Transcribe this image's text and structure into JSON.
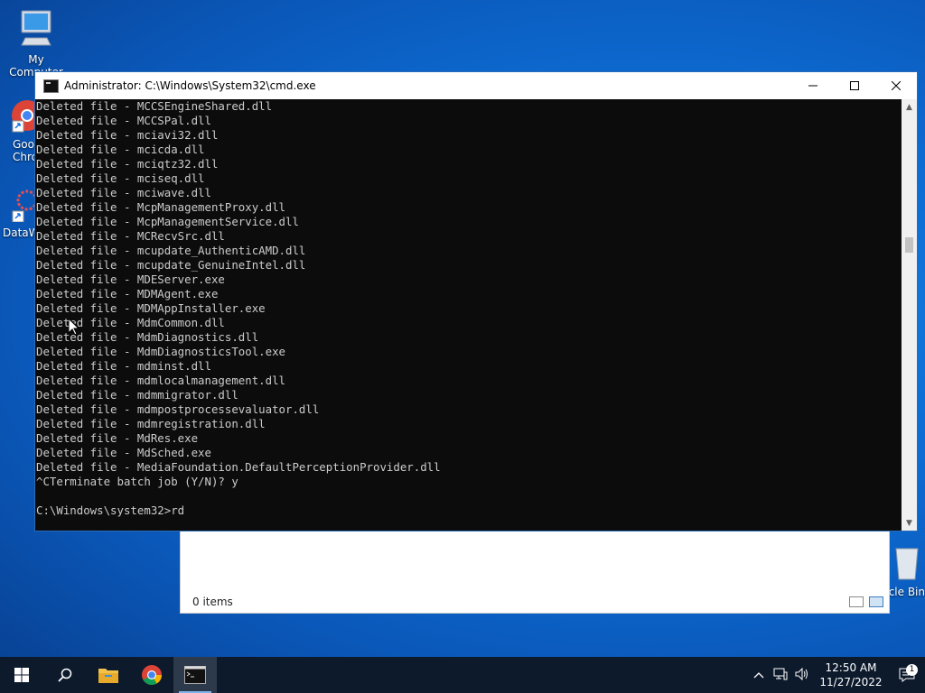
{
  "desktop": {
    "icons": [
      {
        "label": "My Computer",
        "icon": "computer-icon"
      },
      {
        "label": "Google Chrome",
        "icon": "chrome-icon"
      },
      {
        "label": "DataWrangler",
        "icon": "app-shortcut-icon"
      },
      {
        "label": "Recycle Bin",
        "icon": "recycle-bin-icon"
      }
    ]
  },
  "explorer": {
    "status": "0 items"
  },
  "cmd": {
    "title": "Administrator:  C:\\Windows\\System32\\cmd.exe",
    "lines": [
      "Deleted file - MCCSEngineShared.dll",
      "Deleted file - MCCSPal.dll",
      "Deleted file - mciavi32.dll",
      "Deleted file - mcicda.dll",
      "Deleted file - mciqtz32.dll",
      "Deleted file - mciseq.dll",
      "Deleted file - mciwave.dll",
      "Deleted file - McpManagementProxy.dll",
      "Deleted file - McpManagementService.dll",
      "Deleted file - MCRecvSrc.dll",
      "Deleted file - mcupdate_AuthenticAMD.dll",
      "Deleted file - mcupdate_GenuineIntel.dll",
      "Deleted file - MDEServer.exe",
      "Deleted file - MDMAgent.exe",
      "Deleted file - MDMAppInstaller.exe",
      "Deleted file - MdmCommon.dll",
      "Deleted file - MdmDiagnostics.dll",
      "Deleted file - MdmDiagnosticsTool.exe",
      "Deleted file - mdminst.dll",
      "Deleted file - mdmlocalmanagement.dll",
      "Deleted file - mdmmigrator.dll",
      "Deleted file - mdmpostprocessevaluator.dll",
      "Deleted file - mdmregistration.dll",
      "Deleted file - MdRes.exe",
      "Deleted file - MdSched.exe",
      "Deleted file - MediaFoundation.DefaultPerceptionProvider.dll",
      "^CTerminate batch job (Y/N)? y",
      "",
      "C:\\Windows\\system32>rd"
    ],
    "scroll_position": 0.3
  },
  "taskbar": {
    "start_icon": "windows-logo-icon",
    "search_icon": "search-icon",
    "pinned": [
      {
        "name": "file-explorer",
        "icon": "folder-icon"
      },
      {
        "name": "chrome",
        "icon": "chrome-icon"
      },
      {
        "name": "command-prompt",
        "icon": "terminal-icon"
      }
    ],
    "time": "12:50 AM",
    "date": "11/27/2022",
    "notification_count": "1"
  },
  "colors": {
    "desktop_blue": "#0e6fd6",
    "console_bg": "#0c0c0c",
    "console_text": "#cccccc",
    "taskbar_bg": "#0d1a2c"
  }
}
